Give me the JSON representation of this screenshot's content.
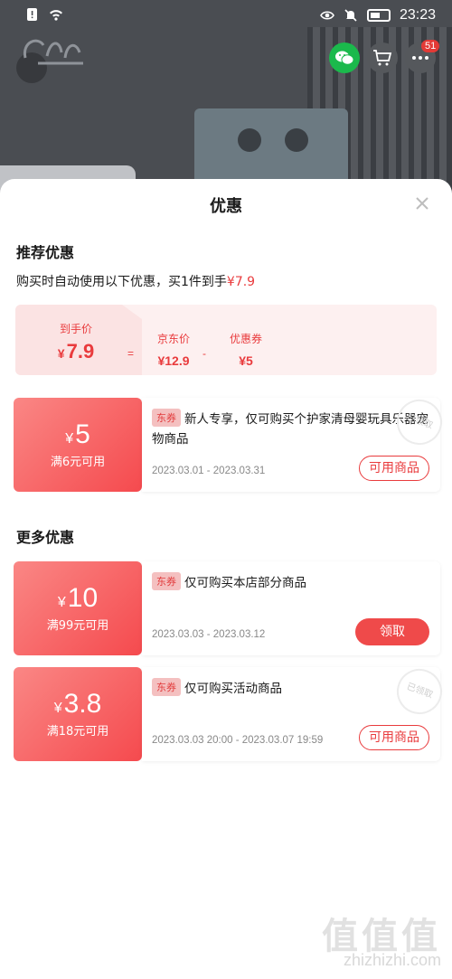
{
  "status_bar": {
    "time": "23:23"
  },
  "header": {
    "cart_badge": "51"
  },
  "sheet": {
    "title": "优惠",
    "recommended": {
      "title": "推荐优惠",
      "desc_prefix": "购买时自动使用以下优惠，买1件到手",
      "desc_price": "¥7.9",
      "calc": {
        "final_label": "到手价",
        "final_yen": "¥",
        "final_value": "7.9",
        "equals": "=",
        "jd_label": "京东价",
        "jd_value": "¥12.9",
        "minus": "-",
        "coupon_label": "优惠券",
        "coupon_value": "¥5"
      }
    },
    "coupons_top": [
      {
        "yen": "¥",
        "amount": "5",
        "condition": "满6元可用",
        "tag": "东券",
        "text": "新人专享，仅可购买个护家清母婴玩具乐器宠物商品",
        "date": "2023.03.01 - 2023.03.31",
        "button": "可用商品",
        "stamp": "已领取"
      }
    ],
    "more": {
      "title": "更多优惠",
      "coupons": [
        {
          "yen": "¥",
          "amount": "10",
          "condition": "满99元可用",
          "tag": "东券",
          "text": "仅可购买本店部分商品",
          "date": "2023.03.03 - 2023.03.12",
          "button": "领取"
        },
        {
          "yen": "¥",
          "amount": "3.8",
          "condition": "满18元可用",
          "tag": "东券",
          "text": "仅可购买活动商品",
          "date": "2023.03.03 20:00 - 2023.03.07 19:59",
          "button": "可用商品",
          "stamp": "已领取"
        }
      ]
    }
  },
  "watermark": {
    "logo": "值值值",
    "site": "zhizhizhi.com"
  },
  "colors": {
    "accent": "#e93b3d",
    "coupon_gradient_start": "#fa8785",
    "coupon_gradient_end": "#f54a4e",
    "calc_bg": "#fdf0f0"
  }
}
